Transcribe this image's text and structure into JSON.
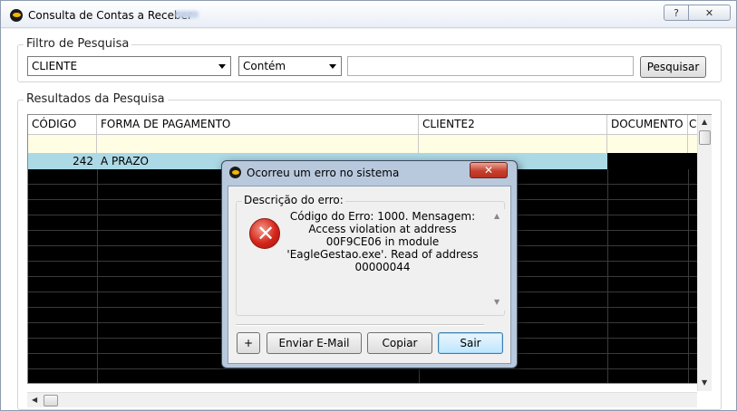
{
  "window": {
    "title": "Consulta de Contas a Receber",
    "help_label": "?",
    "close_label": "✕"
  },
  "filter": {
    "legend": "Filtro de Pesquisa",
    "field": "CLIENTE",
    "operator": "Contém",
    "search_value": "",
    "search_button": "Pesquisar"
  },
  "results": {
    "legend": "Resultados da Pesquisa",
    "columns": [
      "CÓDIGO",
      "FORMA DE PAGAMENTO",
      "CLIENTE2",
      "DOCUMENTO",
      "C"
    ],
    "rows": [
      {
        "codigo": "242",
        "forma": "A PRAZO",
        "cliente2": "",
        "documento": ""
      }
    ]
  },
  "dialog": {
    "title": "Ocorreu um erro no sistema",
    "close_label": "✕",
    "group_label": "Descrição do erro:",
    "message_line1": "Código do Erro: 1000. Mensagem:",
    "message_line2": "Access violation at address",
    "message_line3": "00F9CE06 in module",
    "message_line4": "'EagleGestao.exe'. Read of address",
    "message_line5": "00000044",
    "buttons": {
      "plus": "+",
      "email": "Enviar E-Mail",
      "copy": "Copiar",
      "exit": "Sair"
    }
  },
  "icons": {
    "app": "eagle-logo-icon",
    "error": "error-x-icon"
  },
  "colors": {
    "selected_row": "#acd9e6",
    "filter_row": "#fffde3",
    "grid_background": "#000000",
    "dialog_frame": "#b9c9dd",
    "close_button": "#c8402c"
  }
}
